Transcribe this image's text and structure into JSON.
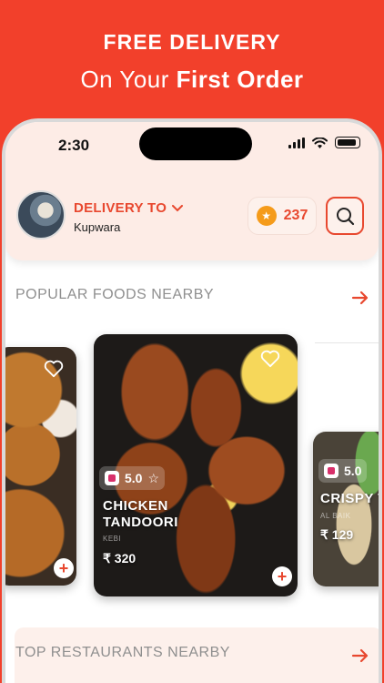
{
  "promo": {
    "line1": "FREE DELIVERY",
    "line2_prefix": "On Your ",
    "line2_bold": "First Order"
  },
  "status_bar": {
    "time": "2:30",
    "icons": [
      "signal-icon",
      "wifi-icon",
      "battery-icon"
    ]
  },
  "header": {
    "avatar": "user-avatar",
    "delivery_label": "DELIVERY TO",
    "location": "Kupwara",
    "coins": "237",
    "coin_icon": "star-coin-icon",
    "search_icon": "search-icon"
  },
  "popular": {
    "title": "POPULAR FOODS NEARBY",
    "arrow_icon": "arrow-right-icon",
    "foods": [
      {
        "name_line1": "CHICKEN",
        "name_line2": "TANDOORI",
        "subtitle": "KEBI",
        "rating": "5.0",
        "price": "₹ 320"
      },
      {
        "name_line1": "CRISPY T",
        "name_line2": "",
        "subtitle": "AL BAIK",
        "rating": "5.0",
        "price": "₹ 129"
      }
    ]
  },
  "restaurants": {
    "title": "TOP RESTAURANTS NEARBY",
    "arrow_icon": "arrow-right-icon"
  },
  "colors": {
    "brand": "#f2402b",
    "accent": "#e8482f",
    "header_bg": "#fdece6",
    "coin": "#f59b1a"
  }
}
